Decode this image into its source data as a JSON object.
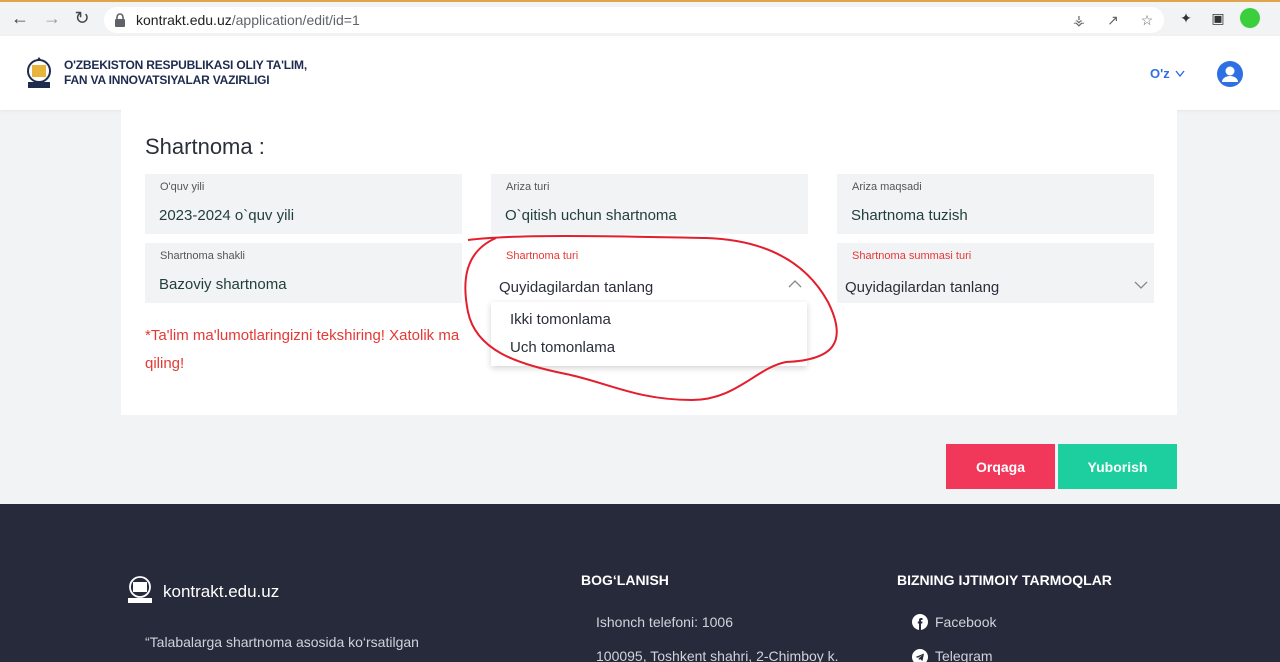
{
  "browser": {
    "url_host": "kontrakt.edu.uz",
    "url_path": "/application/edit/id=1"
  },
  "header": {
    "org_line1": "O'ZBEKISTON RESPUBLIKASI OLIY TA'LIM,",
    "org_line2": "FAN VA INNOVATSIYALAR VAZIRLIGI",
    "lang": "O'z"
  },
  "card": {
    "title": "Shartnoma :",
    "fields": [
      {
        "label": "O'quv yili",
        "value": "2023-2024 o`quv yili"
      },
      {
        "label": "Ariza turi",
        "value": "O`qitish uchun shartnoma"
      },
      {
        "label": "Ariza maqsadi",
        "value": "Shartnoma tuzish"
      },
      {
        "label": "Shartnoma shakli",
        "value": "Bazoviy shartnoma"
      },
      {
        "label": "Shartnoma turi",
        "value": "Quyidagilardan tanlang"
      },
      {
        "label": "Shartnoma summasi turi",
        "value": "Quyidagilardan tanlang"
      }
    ],
    "error_line1": "*Ta'lim ma'lumotlaringizni tekshiring! Xatolik ma",
    "error_line2": "qiling!"
  },
  "dropdown": {
    "options": [
      "Ikki tomonlama",
      "Uch tomonlama"
    ]
  },
  "buttons": {
    "back": "Orqaga",
    "send": "Yuborish"
  },
  "footer": {
    "site": "kontrakt.edu.uz",
    "quote": "“Talabalarga shartnoma asosida ko‘rsatilgan",
    "contact_heading": "BOG‘LANISH",
    "phone": "Ishonch telefoni: 1006",
    "address": "100095, Toshkent shahri, 2-Chimboy k.",
    "social_heading": "BIZNING IJTIMOIY TARMOQLAR",
    "social": [
      "Facebook",
      "Telegram"
    ]
  },
  "colors": {
    "accent_blue": "#2f6fe4",
    "error_red": "#e53935",
    "back_button": "#f2385a",
    "send_button": "#1dcf9f",
    "footer_bg": "#272a3a"
  }
}
